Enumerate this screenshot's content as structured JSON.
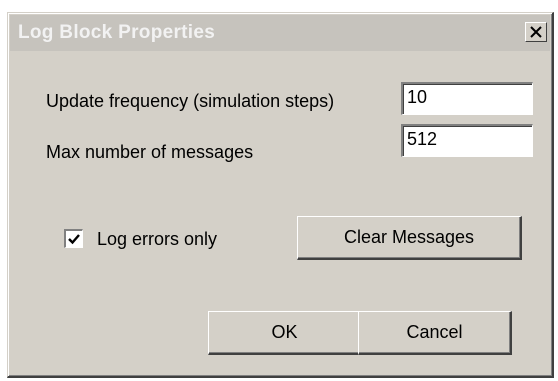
{
  "window": {
    "title": "Log Block Properties",
    "close_glyph": "✕"
  },
  "fields": {
    "update_frequency": {
      "label": "Update frequency (simulation steps)",
      "value": "10"
    },
    "max_messages": {
      "label": "Max number of messages",
      "value": "512"
    }
  },
  "options": {
    "log_errors_only": {
      "label": "Log errors only",
      "checked": true
    }
  },
  "buttons": {
    "clear_messages": "Clear Messages",
    "ok": "OK",
    "cancel": "Cancel"
  },
  "icons": {
    "close": "close-icon",
    "check": "checkmark-icon"
  },
  "colors": {
    "face": "#d4d0c8",
    "title_bar": "#c6c3bd",
    "title_text": "#f2f2f2"
  }
}
